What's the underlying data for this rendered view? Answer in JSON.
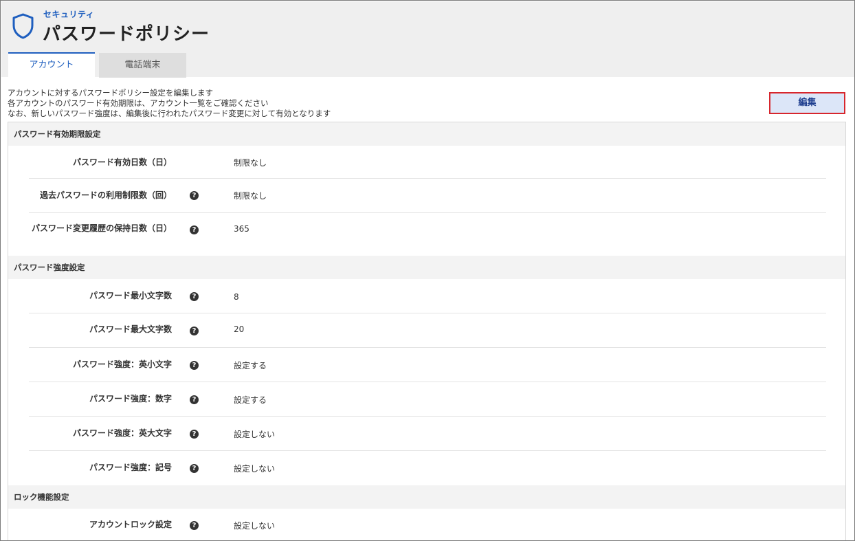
{
  "header": {
    "category": "セキュリティ",
    "title": "パスワードポリシー",
    "icon": "shield-icon"
  },
  "tabs": [
    {
      "label": "アカウント",
      "active": true
    },
    {
      "label": "電話端末",
      "active": false
    }
  ],
  "description": [
    "アカウントに対するパスワードポリシー設定を編集します",
    "各アカウントのパスワード有効期限は、アカウント一覧をご確認ください",
    "なお、新しいパスワード強度は、編集後に行われたパスワード変更に対して有効となります"
  ],
  "edit_label": "編集",
  "sections": [
    {
      "title": "パスワード有効期限設定",
      "rows": [
        {
          "label": "パスワード有効日数（日）",
          "value": "制限なし",
          "help": false
        },
        {
          "label": "過去パスワードの利用制限数（回）",
          "value": "制限なし",
          "help": true
        },
        {
          "label": "パスワード変更履歴の保持日数（日）",
          "value": "365",
          "help": true
        }
      ]
    },
    {
      "title": "パスワード強度設定",
      "rows": [
        {
          "label": "パスワード最小文字数",
          "value": "8",
          "help": true
        },
        {
          "label": "パスワード最大文字数",
          "value": "20",
          "help": true
        },
        {
          "label": "パスワード強度：英小文字",
          "value": "設定する",
          "help": true
        },
        {
          "label": "パスワード強度：数字",
          "value": "設定する",
          "help": true
        },
        {
          "label": "パスワード強度：英大文字",
          "value": "設定しない",
          "help": true
        },
        {
          "label": "パスワード強度：記号",
          "value": "設定しない",
          "help": true
        }
      ]
    },
    {
      "title": "ロック機能設定",
      "rows": [
        {
          "label": "アカウントロック設定",
          "value": "設定しない",
          "help": true
        }
      ]
    }
  ],
  "colors": {
    "accent": "#1f5fbf",
    "edit_button_bg": "#dce6f8",
    "edit_button_border": "#d7262d",
    "header_bg": "#efefef"
  }
}
